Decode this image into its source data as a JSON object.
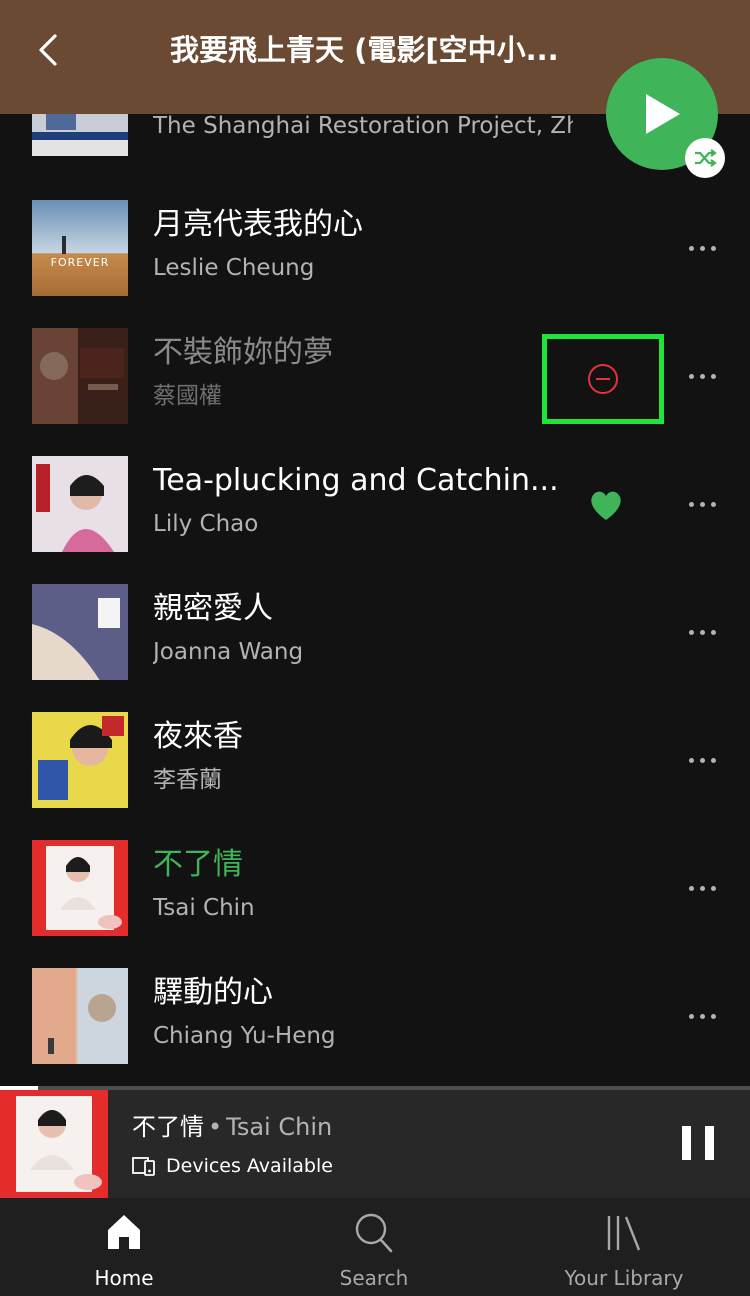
{
  "header": {
    "title": "我要飛上青天 (電影[空中小..."
  },
  "tracks": [
    {
      "title": "",
      "artist": "The Shanghai Restoration Project, Zhang"
    },
    {
      "title": "月亮代表我的心",
      "artist": "Leslie Cheung",
      "cover_text": "FOREVER"
    },
    {
      "title": "不裝飾妳的夢",
      "artist": "蔡國權"
    },
    {
      "title": "Tea-plucking and Catchin...",
      "artist": "Lily Chao"
    },
    {
      "title": "親密愛人",
      "artist": "Joanna Wang"
    },
    {
      "title": "夜來香",
      "artist": "李香蘭"
    },
    {
      "title": "不了情",
      "artist": "Tsai Chin"
    },
    {
      "title": "驛動的心",
      "artist": "Chiang Yu-Heng"
    }
  ],
  "now_playing": {
    "title": "不了情",
    "separator": "•",
    "artist": "Tsai Chin",
    "devices_label": "Devices Available",
    "progress": 0.05
  },
  "tabs": [
    {
      "label": "Home",
      "icon": "home-icon",
      "active": true
    },
    {
      "label": "Search",
      "icon": "search-icon",
      "active": false
    },
    {
      "label": "Your Library",
      "icon": "library-icon",
      "active": false
    }
  ],
  "colors": {
    "accent": "#3fb458",
    "header_bg": "#6b4a34",
    "background": "#121212",
    "highlight_box": "#22e33a",
    "remove_icon": "#e0343a"
  }
}
